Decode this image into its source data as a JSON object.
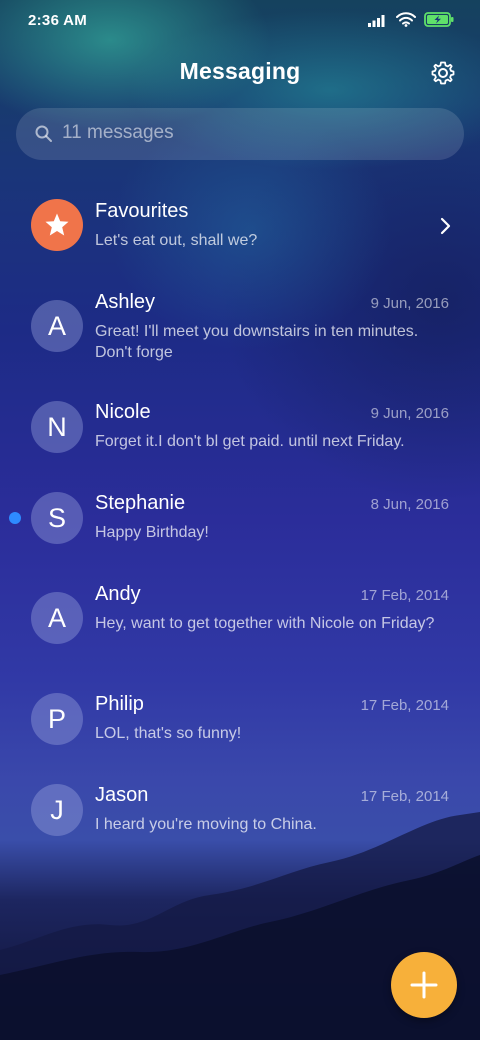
{
  "status_bar": {
    "time": "2:36 AM",
    "icons": [
      "signal-icon",
      "wifi-icon",
      "battery-charging-icon"
    ]
  },
  "header": {
    "title": "Messaging",
    "settings_icon": "gear-icon"
  },
  "search": {
    "placeholder": "11 messages",
    "icon": "search-icon"
  },
  "favourites": {
    "name": "Favourites",
    "snippet": "Let's eat out, shall we?",
    "icon": "star-icon"
  },
  "conversations": [
    {
      "initial": "A",
      "name": "Ashley",
      "date": "9 Jun, 2016",
      "snippet": "Great! I'll meet you downstairs in ten minutes. Don't forge",
      "unread": false
    },
    {
      "initial": "N",
      "name": "Nicole",
      "date": "9 Jun, 2016",
      "snippet": "Forget it.I don't bl get paid. until next Friday.",
      "unread": false
    },
    {
      "initial": "S",
      "name": "Stephanie",
      "date": "8 Jun, 2016",
      "snippet": "Happy Birthday!",
      "unread": true
    },
    {
      "initial": "A",
      "name": "Andy",
      "date": "17 Feb, 2014",
      "snippet": "Hey, want to get together with Nicole on Friday?",
      "unread": false
    },
    {
      "initial": "P",
      "name": "Philip",
      "date": "17 Feb, 2014",
      "snippet": "LOL, that's so funny!",
      "unread": false
    },
    {
      "initial": "J",
      "name": "Jason",
      "date": "17 Feb, 2014",
      "snippet": "I heard you're moving to China.",
      "unread": false
    }
  ],
  "fab": {
    "icon": "plus-icon"
  },
  "colors": {
    "favourites_avatar": "#f0744a",
    "unread_dot": "#2e8bff",
    "fab": "#f7b03a",
    "battery": "#5fe06a"
  }
}
